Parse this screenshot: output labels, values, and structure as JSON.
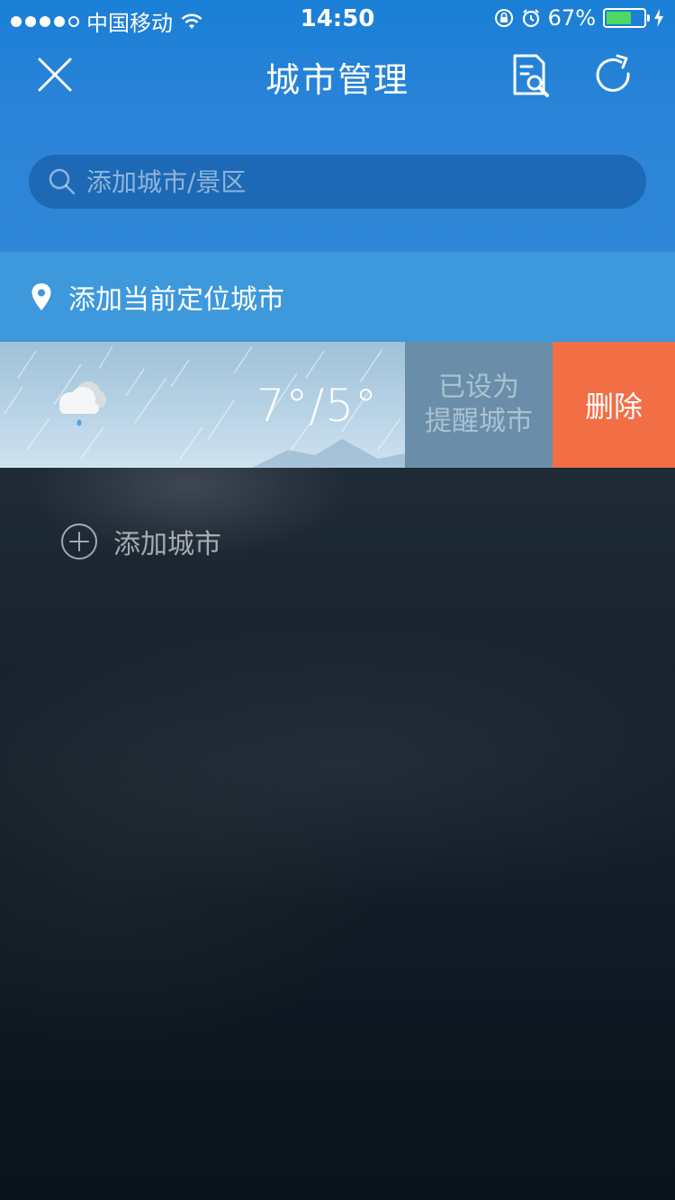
{
  "status_bar": {
    "carrier": "中国移动",
    "time": "14:50",
    "battery_percent": "67%",
    "battery_level": 0.67,
    "icons": [
      "signal-dots",
      "wifi-icon",
      "rotation-lock-icon",
      "alarm-icon",
      "battery-icon",
      "charging-bolt-icon"
    ]
  },
  "nav": {
    "title": "城市管理",
    "close_icon": "close-icon",
    "edit_icon": "edit-settings-icon",
    "refresh_icon": "refresh-icon"
  },
  "search": {
    "placeholder": "添加城市/景区",
    "value": ""
  },
  "locate": {
    "label": "添加当前定位城市",
    "icon": "location-pin-icon"
  },
  "city_card": {
    "temperature": "7°/5°",
    "weather_icon": "cloudy-rain-icon",
    "reminder_line1": "已设为",
    "reminder_line2": "提醒城市",
    "delete_label": "删除"
  },
  "add_city": {
    "label": "添加城市",
    "icon": "add-circle-icon"
  },
  "colors": {
    "header_blue": "#2a84d8",
    "locate_blue": "#3d98dc",
    "reminder_gray_blue": "#6a8ea9",
    "delete_orange": "#f26e45",
    "dark_bg": "#0b1620"
  }
}
